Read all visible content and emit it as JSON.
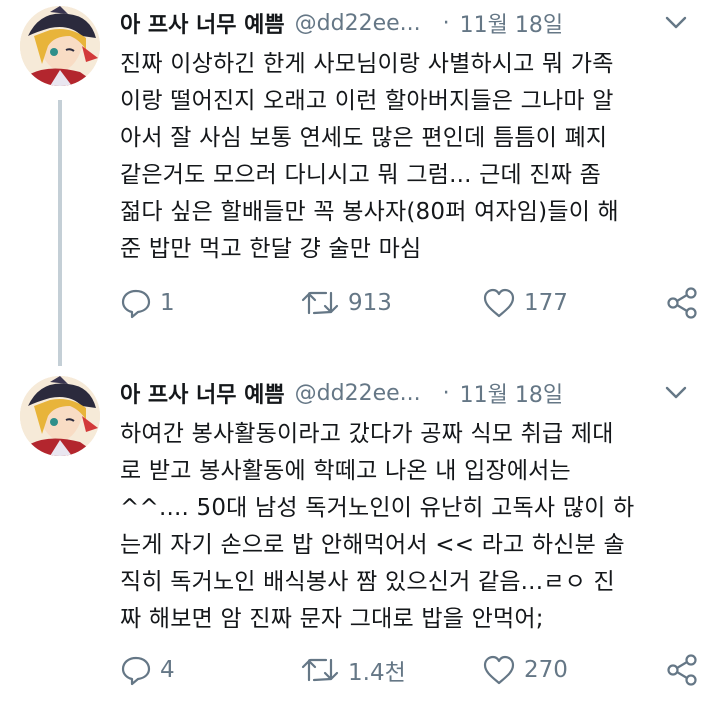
{
  "tweets": [
    {
      "name": "아 프사 너무 예쁨",
      "handle": "@dd22ee...",
      "separator": "·",
      "date": "11월 18일",
      "text": "진짜 이상하긴 한게 사모님이랑 사별하시고 뭐 가족\n이랑 떨어진지 오래고 이런 할아버지들은 그나마 알\n아서 잘 사심 보통 연세도 많은 편인데 틈틈이 폐지\n같은거도 모으러 다니시고 뭐 그럼... 근데 진짜 좀\n젊다 싶은 할배들만 꼭 봉사자(80퍼 여자임)들이 해\n준 밥만 먹고 한달 걍 술만 마심",
      "replies": "1",
      "retweets": "913",
      "likes": "177"
    },
    {
      "name": "아 프사 너무 예쁨",
      "handle": "@dd22ee...",
      "separator": "·",
      "date": "11월 18일",
      "text": "하여간 봉사활동이라고 갔다가 공짜 식모 취급 제대\n로 받고 봉사활동에 학떼고 나온 내 입장에서는\n^^.... 50대 남성 독거노인이 유난히 고독사 많이 하\n는게 자기 손으로 밥 안해먹어서 << 라고 하신분 솔\n직히 독거노인 배식봉사 짬 있으신거 같음...ㄹㅇ 진\n짜 해보면 암 진짜 문자 그대로 밥을 안먹어;",
      "replies": "4",
      "retweets": "1.4천",
      "likes": "270"
    }
  ],
  "colors": {
    "text": "#14171a",
    "muted": "#657786",
    "thread_line": "#c4cfd6"
  },
  "icons": [
    "avatar",
    "chevron-down-icon",
    "reply-icon",
    "retweet-icon",
    "like-icon",
    "share-icon"
  ]
}
